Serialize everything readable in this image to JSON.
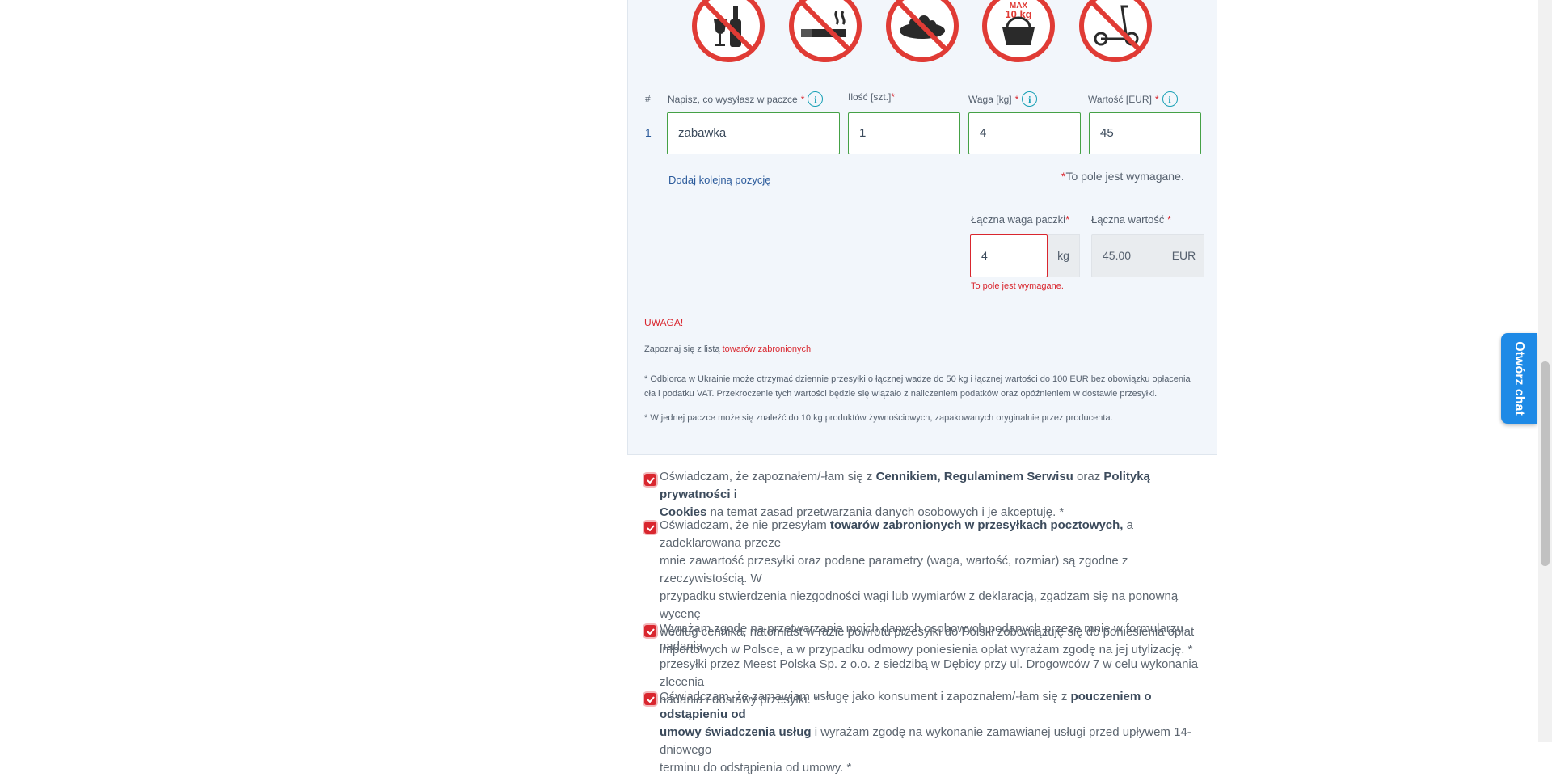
{
  "prohibited_icons": [
    {
      "name": "no-alcohol-icon"
    },
    {
      "name": "no-cigarettes-icon"
    },
    {
      "name": "no-food-icon"
    },
    {
      "name": "food-max-weight-icon",
      "text": "MAX 10 kg"
    },
    {
      "name": "no-scooter-icon"
    }
  ],
  "items_table": {
    "col_hash": "#",
    "col_description": "Napisz, co wysyłasz w paczce",
    "col_quantity": "Ilość [szt.]",
    "col_weight": "Waga [kg]",
    "col_value": "Wartość [EUR]",
    "required_mark": "*",
    "info_glyph": "i",
    "row": {
      "number": "1",
      "description": "zabawka",
      "quantity": "1",
      "weight": "4",
      "value": "45"
    },
    "add_item_link": "Dodaj kolejną pozycję",
    "required_note": "To pole jest wymagane."
  },
  "totals": {
    "weight_label": "Łączna waga paczki",
    "weight_value": "4",
    "weight_unit": "kg",
    "weight_error": "To pole jest wymagane.",
    "value_label": "Łączna wartość",
    "value_value": "45.00",
    "value_unit": "EUR"
  },
  "notes": {
    "warning": "UWAGA!",
    "prohibited_prefix": "Zapoznaj się z listą",
    "prohibited_link": "towarów zabronionych",
    "ukraine_line1": "* Odbiorca w Ukrainie może otrzymać dziennie przesyłki o łącznej wadze do 50 kg i łącznej wartości do 100 EUR bez obowiązku opłacenia",
    "ukraine_line2": "cła i podatku VAT. Przekroczenie tych wartości będzie się wiązało z naliczeniem podatków oraz opóźnieniem w dostawie przesyłki.",
    "food_note": "* W jednej paczce może się znaleźć do 10 kg produktów żywnościowych, zapakowanych oryginalnie przez producenta."
  },
  "consents": {
    "c1": {
      "l1_a": "Oświadczam, że zapoznałem/-łam się z ",
      "l1_b1": "Cennikiem",
      "l1_c": ", ",
      "l1_b2": "Regulaminem Serwisu",
      "l1_d": " oraz ",
      "l1_b3": "Polityką prywatności i",
      "l2_b": "Cookies",
      "l2_c": " na temat zasad przetwarzania danych osobowych i je akceptuję. *"
    },
    "c2": {
      "l1_a": "Oświadczam, że nie przesyłam ",
      "l1_b": "towarów zabronionych w przesyłkach pocztowych,",
      "l1_c": " a zadeklarowana przeze",
      "l2": "mnie zawartość przesyłki oraz podane parametry (waga, wartość, rozmiar) są zgodne z rzeczywistością. W",
      "l3": "przypadku stwierdzenia niezgodności wagi lub wymiarów z deklaracją, zgadzam się na ponowną wycenę",
      "l4": "według cennika, natomiast w razie powrotu przesyłki do Polski zobowiązuję się do poniesienia opłat",
      "l5": "importowych w Polsce, a w przypadku odmowy poniesienia opłat wyrażam zgodę na jej utylizację. *"
    },
    "c3": {
      "l1": "Wyrażam zgodę na przetwarzanie moich danych osobowych podanych przeze mnie w formularzu nadania",
      "l2": "przesyłki przez Meest Polska Sp. z o.o. z siedzibą w Dębicy przy ul. Drogowców 7 w celu wykonania zlecenia",
      "l3": "nadania i dostawy przesyłki. *"
    },
    "c4": {
      "l1_a": "Oświadczam, że zamawiam usługę jako konsument i zapoznałem/-łam się z ",
      "l1_b": "pouczeniem o odstąpieniu od",
      "l2_b": "umowy świadczenia usług",
      "l2_c": " i wyrażam zgodę na wykonanie zamawianej usługi przed upływem 14-dniowego",
      "l3": "terminu do odstąpienia od umowy. *"
    }
  },
  "chat_button": "Otwórz chat",
  "colors": {
    "accent_red": "#d9262e",
    "link_blue": "#2d5c9c",
    "valid_green": "#45a146",
    "chat_blue": "#1e8ae6"
  }
}
